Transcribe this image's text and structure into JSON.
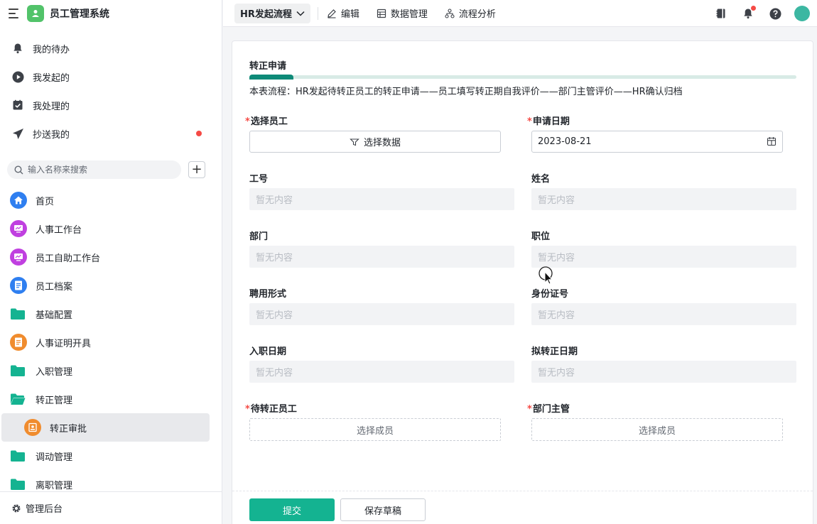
{
  "app": {
    "title": "员工管理系统"
  },
  "quick_menu": [
    {
      "label": "我的待办",
      "icon": "bell-icon"
    },
    {
      "label": "我发起的",
      "icon": "play-circle-icon"
    },
    {
      "label": "我处理的",
      "icon": "checkbox-icon"
    },
    {
      "label": "抄送我的",
      "icon": "send-icon",
      "badge": "red-dot"
    }
  ],
  "search": {
    "placeholder": "输入名称来搜索",
    "add_label": "+"
  },
  "nav": [
    {
      "label": "首页",
      "icon": "home-icon",
      "color": "#2f7ff0"
    },
    {
      "label": "人事工作台",
      "icon": "monitor-icon",
      "color": "#c040e0"
    },
    {
      "label": "员工自助工作台",
      "icon": "monitor-icon",
      "color": "#c040e0"
    },
    {
      "label": "员工档案",
      "icon": "document-icon",
      "color": "#2f7ff0"
    },
    {
      "label": "基础配置",
      "icon": "folder-icon",
      "color": "#14b391"
    },
    {
      "label": "人事证明开具",
      "icon": "document-icon",
      "color": "#f08c2e"
    },
    {
      "label": "入职管理",
      "icon": "folder-icon",
      "color": "#14b391"
    },
    {
      "label": "转正管理",
      "icon": "folder-open-icon",
      "color": "#14b391"
    },
    {
      "label": "转正审批",
      "icon": "approval-icon",
      "color": "#f08c2e",
      "active": true
    },
    {
      "label": "调动管理",
      "icon": "folder-icon",
      "color": "#14b391"
    },
    {
      "label": "离职管理",
      "icon": "folder-icon",
      "color": "#14b391"
    }
  ],
  "footer": {
    "admin_label": "管理后台"
  },
  "topbar": {
    "flow_select": "HR发起流程",
    "actions": [
      {
        "label": "编辑",
        "icon": "pencil-icon"
      },
      {
        "label": "数据管理",
        "icon": "table-icon"
      },
      {
        "label": "流程分析",
        "icon": "flow-icon"
      }
    ]
  },
  "form": {
    "title": "转正申请",
    "progress": 0.08,
    "description": "本表流程：HR发起待转正员工的转正申请——员工填写转正期自我评价——部门主管评价——HR确认归档",
    "select_employee_label": "选择员工",
    "select_data_button": "选择数据",
    "apply_date_label": "申请日期",
    "apply_date_value": "2023-08-21",
    "empty_text": "暂无内容",
    "fields": {
      "employee_no": "工号",
      "name": "姓名",
      "department": "部门",
      "position": "职位",
      "employment_type": "聘用形式",
      "id_number": "身份证号",
      "join_date": "入职日期",
      "regular_date": "拟转正日期"
    },
    "pending_employee_label": "待转正员工",
    "dept_manager_label": "部门主管",
    "select_member": "选择成员",
    "submit_button": "提交",
    "draft_button": "保存草稿"
  }
}
